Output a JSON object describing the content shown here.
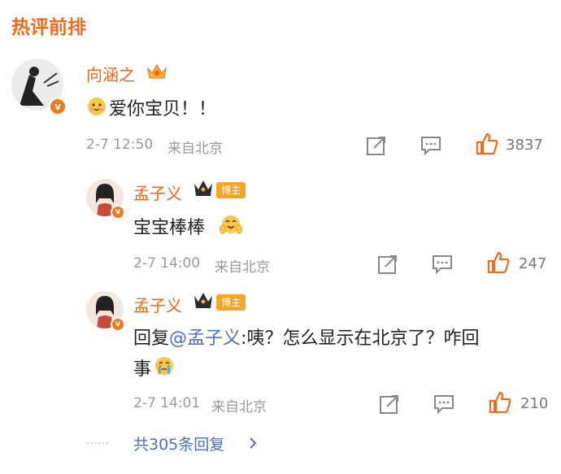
{
  "section_title": "热评前排",
  "main_comment": {
    "username": "向涵之",
    "text": "爱你宝贝！！",
    "timestamp": "2-7 12:50",
    "location": "来自北京",
    "likes": "3837"
  },
  "replies": [
    {
      "username": "孟子义",
      "badge": "博主",
      "text": "宝宝棒棒",
      "timestamp": "2-7 14:00",
      "location": "来自北京",
      "likes": "247"
    },
    {
      "username": "孟子义",
      "badge": "博主",
      "reply_prefix": "回复",
      "mention": "@孟子义",
      "text_line1": ":咦？怎么显示在北京了？咋回",
      "text_line2": "事",
      "timestamp": "2-7 14:01",
      "location": "来自北京",
      "likes": "210"
    }
  ],
  "more_replies": {
    "dots": "……",
    "label": "共305条回复"
  },
  "colors": {
    "accent": "#e8691a",
    "link": "#4a72b8",
    "meta": "#999999"
  },
  "icons": [
    "crown-icon",
    "verified-icon",
    "share-icon",
    "comment-icon",
    "like-icon",
    "chevron-right-icon",
    "hug-emoji-icon",
    "cry-emoji-icon"
  ]
}
